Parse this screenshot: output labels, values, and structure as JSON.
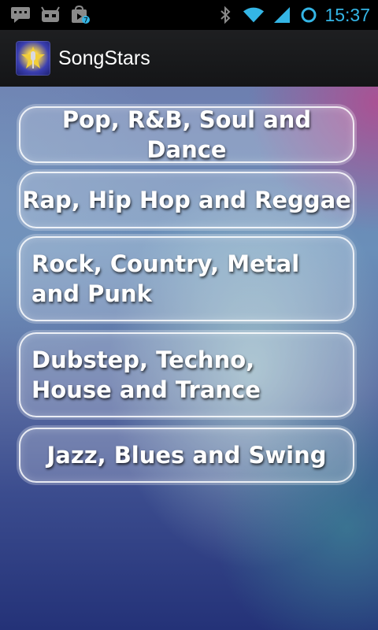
{
  "status_bar": {
    "time": "15:37",
    "left_icons": [
      "message-icon",
      "android-bot-icon",
      "play-store-update-icon"
    ],
    "right_icons": [
      "bluetooth-icon",
      "wifi-icon",
      "cell-signal-icon",
      "battery-ring-icon"
    ],
    "accent_color": "#34b5e5"
  },
  "action_bar": {
    "app_title": "SongStars",
    "app_icon": "microphone-star-icon"
  },
  "genres": [
    {
      "label": "Pop, R&B, Soul and Dance"
    },
    {
      "label": "Rap, Hip Hop and Reggae"
    },
    {
      "label": "Rock, Country, Metal and Punk"
    },
    {
      "label": "Dubstep, Techno, House and Trance"
    },
    {
      "label": "Jazz, Blues and Swing"
    }
  ]
}
